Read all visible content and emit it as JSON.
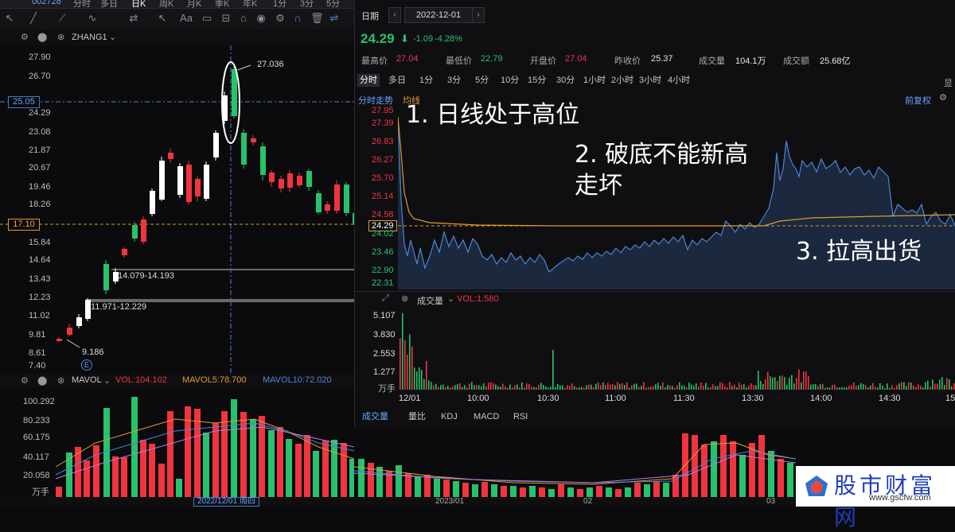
{
  "topbar": {
    "code": "002728",
    "tabs": [
      "分时",
      "多日",
      "日K",
      "周K",
      "月K",
      "季K",
      "年K",
      "1分",
      "3分",
      "5分"
    ]
  },
  "left": {
    "indicator": "ZHANG1",
    "price_ticks": [
      "27.90",
      "26.70",
      "25.05",
      "24.29",
      "23.08",
      "21.87",
      "20.67",
      "19.46",
      "18.26",
      "17.10",
      "15.84",
      "14.64",
      "13.43",
      "12.23",
      "11.02",
      "9.81",
      "8.61",
      "7.40"
    ],
    "current_price_tag": "25.05",
    "dashed_tag": "17.10",
    "labels": {
      "high": "27.036",
      "low": "9.186",
      "range1": "14.079-14.193",
      "range2": "11.971-12.229",
      "event": "E"
    },
    "vol_header": {
      "name": "MAVOL",
      "vol": "VOL:104.102",
      "ma5": "MAVOL5:78.700",
      "ma10": "MAVOL10:72.020"
    },
    "vol_ticks": [
      "100.292",
      "80.233",
      "60.175",
      "40.117",
      "20.058"
    ],
    "vol_unit": "万手",
    "x_labels": [
      "2022/12/01 周四",
      "2023/01",
      "02",
      "03"
    ]
  },
  "intraday": {
    "date_label": "日期",
    "date": "2022-12-01",
    "price": "24.29",
    "change": "-1.09",
    "change_pct": "-4.28%",
    "stats": [
      {
        "k": "最高价",
        "v": "27.04",
        "c": "red"
      },
      {
        "k": "最低价",
        "v": "22.79",
        "c": "green"
      },
      {
        "k": "开盘价",
        "v": "27.04",
        "c": "red"
      },
      {
        "k": "昨收价",
        "v": "25.37",
        "c": "white"
      },
      {
        "k": "成交量",
        "v": "104.1万",
        "c": "white"
      },
      {
        "k": "成交额",
        "v": "25.68亿",
        "c": "white"
      }
    ],
    "periods": [
      "分时",
      "多日",
      "1分",
      "3分",
      "5分",
      "10分",
      "15分",
      "30分",
      "1小时",
      "2小时",
      "3小时",
      "4小时"
    ],
    "sub_tabs": [
      "分时走势",
      "均线"
    ],
    "adjust": "前复权",
    "price_ticks": [
      "27.95",
      "27.39",
      "26.83",
      "26.27",
      "25.70",
      "25.14",
      "24.58",
      "24.29",
      "24.02",
      "23.46",
      "22.90",
      "22.31"
    ],
    "vol_header": {
      "name": "成交量",
      "value": "VOL:1.580"
    },
    "vol_ticks": [
      "5.107",
      "3.830",
      "2.553",
      "1.277"
    ],
    "vol_unit": "万手",
    "time_labels": [
      "12/01",
      "10:00",
      "10:30",
      "11:00",
      "11:30",
      "13:30",
      "14:00",
      "14:30",
      "15"
    ],
    "bottom_tabs": [
      "成交量",
      "量比",
      "KDJ",
      "MACD",
      "RSI"
    ]
  },
  "annotations": [
    "1. 日线处于高位",
    "2. 破底不能新高",
    "走坏",
    "3. 拉高出货"
  ],
  "watermark": {
    "text": "股市财富网",
    "url": "www.gscfw.com"
  },
  "colors": {
    "up": "#f2343f",
    "down": "#27c26b",
    "avg": "#e39a2c",
    "price": "#4a86d8"
  }
}
